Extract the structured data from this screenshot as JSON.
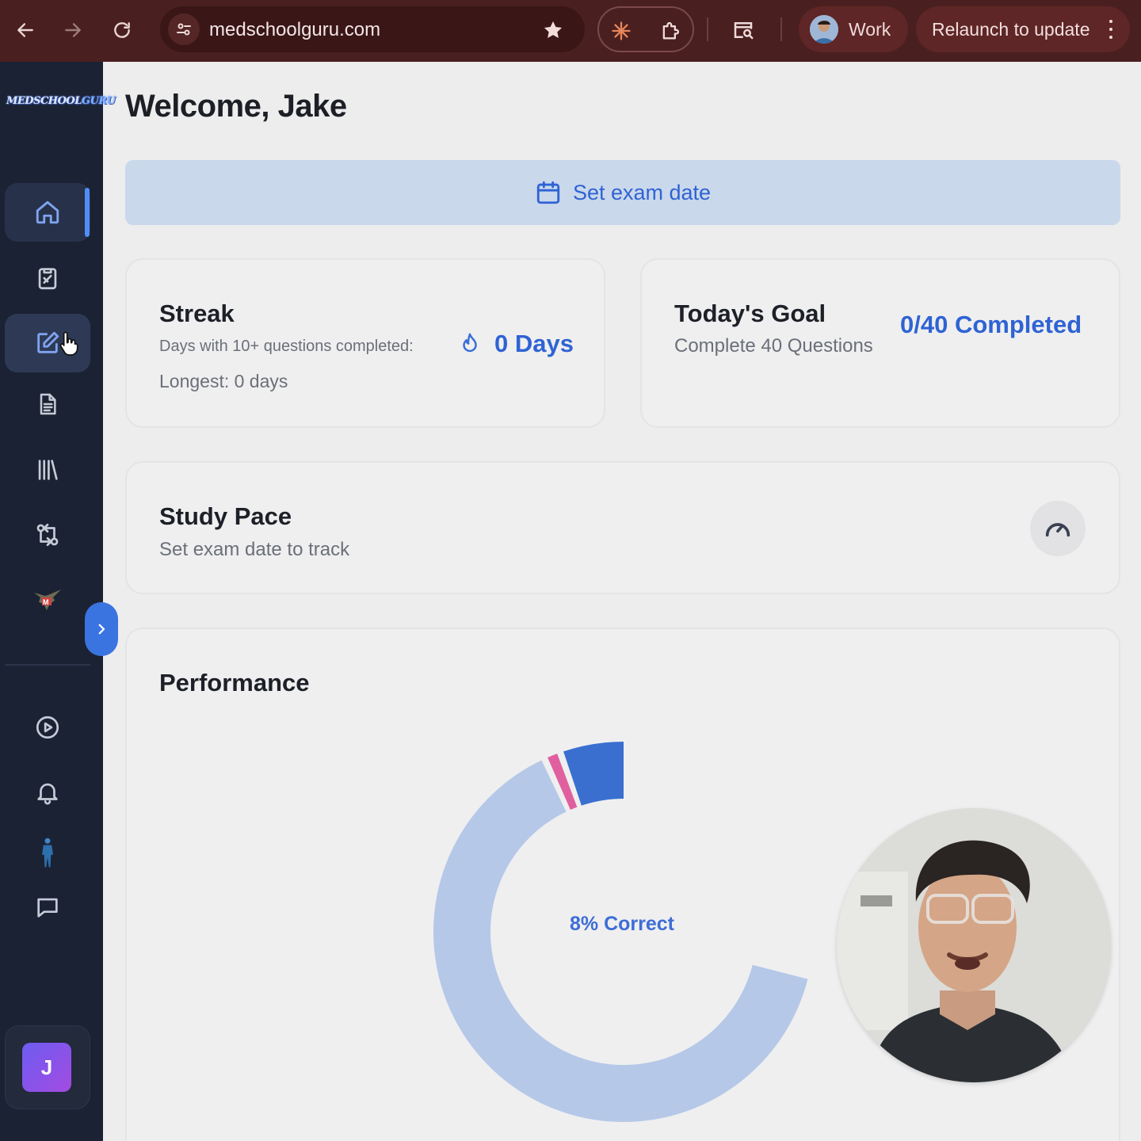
{
  "browser": {
    "url": "medschoolguru.com",
    "profile_label": "Work",
    "relaunch_label": "Relaunch to update"
  },
  "sidebar": {
    "logo_text_a": "MEDSCHOOL",
    "logo_text_b": "GURU",
    "user_initial": "J",
    "items": [
      {
        "name": "home",
        "active": true
      },
      {
        "name": "practice"
      },
      {
        "name": "create-test"
      },
      {
        "name": "notes"
      },
      {
        "name": "library"
      },
      {
        "name": "pathways"
      },
      {
        "name": "mascot"
      },
      {
        "name": "videos"
      },
      {
        "name": "notifications"
      },
      {
        "name": "anatomy"
      },
      {
        "name": "chat"
      }
    ]
  },
  "main": {
    "welcome": "Welcome, Jake",
    "exam_banner_label": "Set exam date",
    "streak": {
      "title": "Streak",
      "subtitle": "Days with 10+ questions completed:",
      "value": "0 Days",
      "longest": "Longest: 0 days"
    },
    "goal": {
      "title": "Today's Goal",
      "subtitle": "Complete 40 Questions",
      "value": "0/40 Completed"
    },
    "pace": {
      "title": "Study Pace",
      "subtitle": "Set exam date to track"
    },
    "performance": {
      "title": "Performance",
      "center_label": "8% Correct"
    }
  },
  "chart_data": {
    "type": "pie",
    "donut": true,
    "slices": [
      {
        "value": 8,
        "color": "#3a6fd0"
      },
      {
        "value": 2,
        "color": "#e0609f"
      },
      {
        "value": 90,
        "color": "#b6c8e8"
      }
    ],
    "center_label": "8% Correct",
    "visible_fraction": 0.71
  },
  "colors": {
    "accent": "#2f63d3",
    "sidebar_bg": "#1b2233",
    "chrome_bg": "#4a1f1f"
  }
}
